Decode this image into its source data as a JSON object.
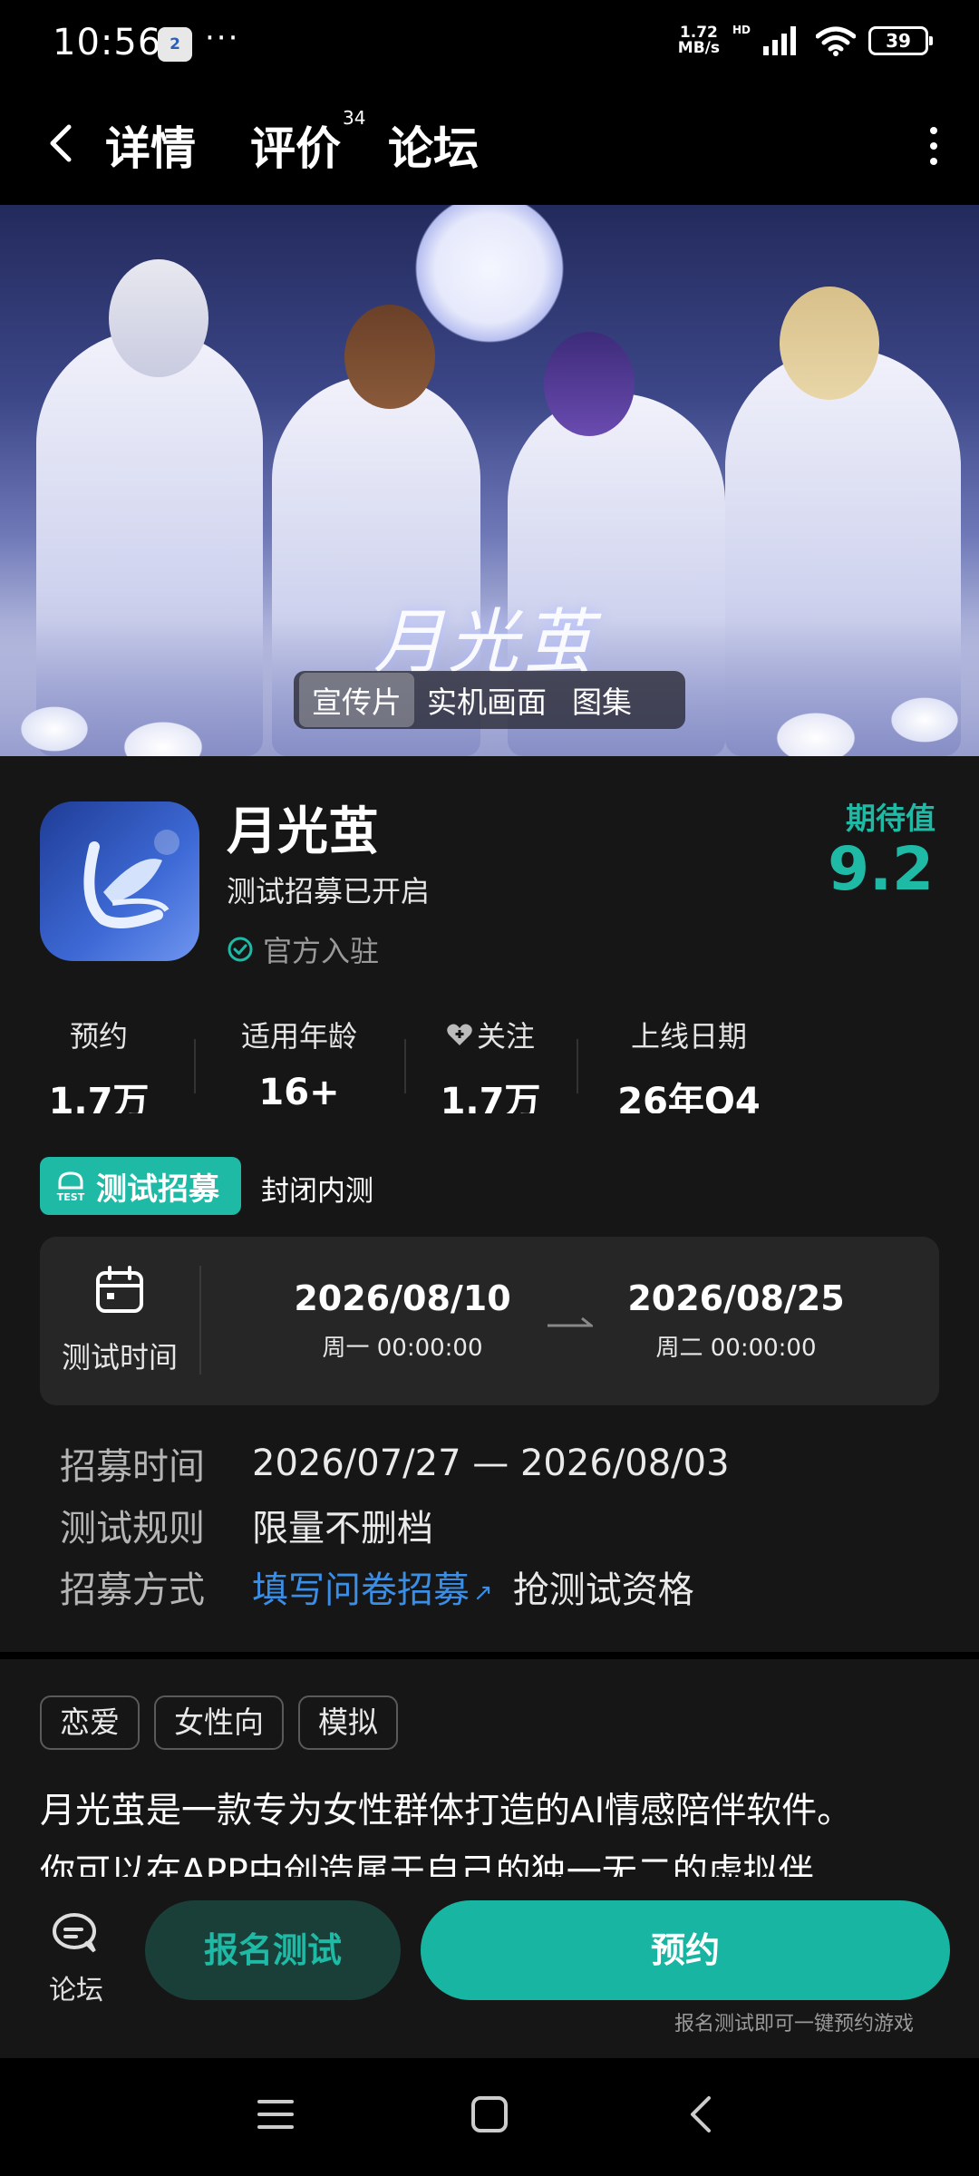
{
  "status_bar": {
    "time": "10:56",
    "notification_badge": "2",
    "more": "···",
    "net_speed_value": "1.72",
    "net_speed_unit": "MB/s",
    "network_type": "HD",
    "battery": "39"
  },
  "nav": {
    "tabs": [
      {
        "label": "详情",
        "active": true
      },
      {
        "label": "评价",
        "count": "34"
      },
      {
        "label": "论坛"
      }
    ]
  },
  "banner": {
    "logo_text": "月光茧",
    "media_tabs": [
      "宣传片",
      "实机画面",
      "图集"
    ],
    "active_media_tab": "宣传片"
  },
  "app": {
    "name": "月光茧",
    "subtitle": "测试招募已开启",
    "official_label": "官方入驻",
    "expect_label": "期待值",
    "expect_score": "9.2"
  },
  "stats": [
    {
      "label": "预约",
      "value": "1.7万"
    },
    {
      "label": "适用年龄",
      "value": "16+"
    },
    {
      "label": "关注",
      "value": "1.7万"
    },
    {
      "label": "上线日期",
      "value": "26年Q4"
    }
  ],
  "recruit": {
    "badge_label": "测试招募",
    "badge_icon_text": "TEST",
    "type": "封闭内测"
  },
  "test_time": {
    "label": "测试时间",
    "start_date": "2026/08/10",
    "start_time": "周一  00:00:00",
    "end_date": "2026/08/25",
    "end_time": "周二  00:00:00"
  },
  "details": {
    "recruit_time_label": "招募时间",
    "recruit_time_value": "2026/07/27 — 2026/08/03",
    "rule_label": "测试规则",
    "rule_value": "限量不删档",
    "method_label": "招募方式",
    "method_link": "填写问卷招募",
    "method_link_arrow": "↗",
    "method_other": "抢测试资格"
  },
  "description": {
    "tags": [
      "恋爱",
      "女性向",
      "模拟"
    ],
    "line1": "月光茧是一款专为女性群体打造的AI情感陪伴软件。",
    "line2": "你可以在APP中创造属于自己的独一无二的虚拟伴"
  },
  "actions": {
    "forum_label": "论坛",
    "signup_label": "报名测试",
    "reserve_label": "预约",
    "reserve_hint": "报名测试即可一键预约游戏"
  },
  "colors": {
    "accent": "#18b6a2",
    "link": "#3a8ee6",
    "panel": "#161616",
    "card": "#262626"
  }
}
